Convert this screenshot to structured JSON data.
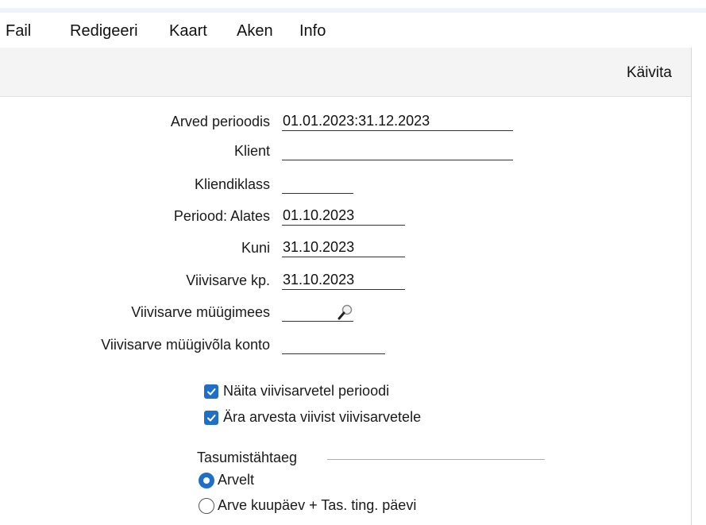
{
  "menu": {
    "items": [
      "Fail",
      "Redigeeri",
      "Kaart",
      "Aken",
      "Info"
    ]
  },
  "toolbar": {
    "run_label": "Käivita"
  },
  "form": {
    "fields": [
      {
        "label": "Arved perioodis",
        "value": "01.01.2023:31.12.2023"
      },
      {
        "label": "Klient",
        "value": ""
      },
      {
        "label": "Kliendiklass",
        "value": ""
      },
      {
        "label": "Periood: Alates",
        "value": "01.10.2023"
      },
      {
        "label": "Kuni",
        "value": "31.10.2023"
      },
      {
        "label": "Viivisarve kp.",
        "value": "31.10.2023"
      },
      {
        "label": "Viivisarve müügimees",
        "value": ""
      },
      {
        "label": "Viivisarve müügivõla konto",
        "value": ""
      }
    ],
    "checkboxes": [
      {
        "label": "Näita viivisarvetel perioodi",
        "checked": true
      },
      {
        "label": "Ära arvesta viivist viivisarvetele",
        "checked": true
      }
    ],
    "payment_group": {
      "title": "Tasumistähtaeg",
      "options": [
        {
          "label": "Arvelt",
          "selected": true
        },
        {
          "label": "Arve kuupäev + Tas. ting. päevi",
          "selected": false
        }
      ]
    }
  },
  "colors": {
    "accent": "#1f6ec7",
    "toolbar_bg": "#f4f4f4"
  }
}
